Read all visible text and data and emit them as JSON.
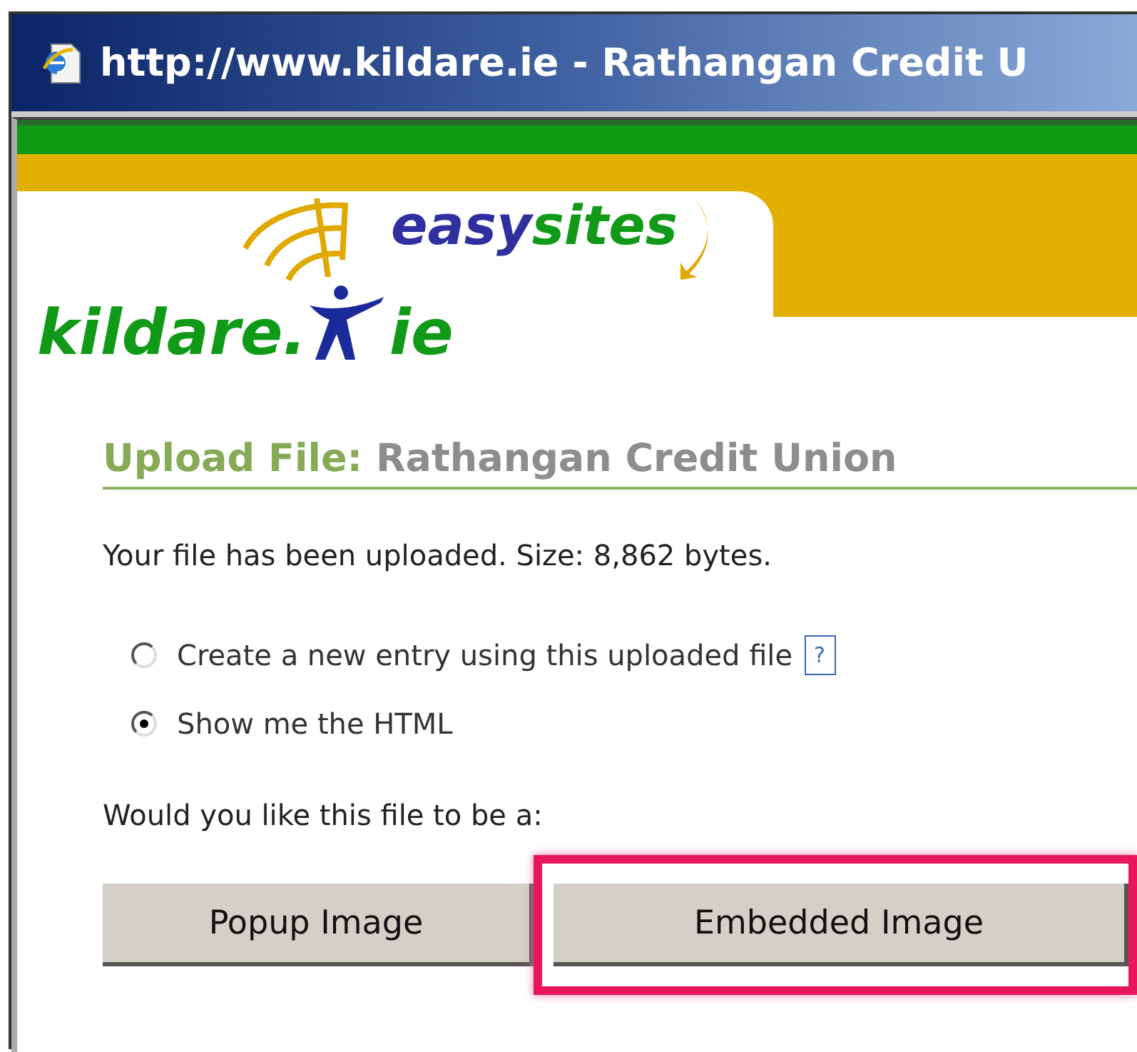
{
  "window": {
    "title": "http://www.kildare.ie - Rathangan Credit U"
  },
  "logo": {
    "brand_parts": [
      "easy",
      "sites"
    ],
    "site_parts": [
      "kildare.",
      "ie"
    ]
  },
  "heading": {
    "label": "Upload File:",
    "name": "Rathangan Credit Union"
  },
  "message": "Your file has been uploaded. Size: 8,862 bytes.",
  "options": [
    {
      "label": "Create a new entry using this uploaded file",
      "selected": false,
      "help": "?"
    },
    {
      "label": "Show me the HTML",
      "selected": true
    }
  ],
  "question": "Would you like this file to be a:",
  "buttons": [
    {
      "label": "Popup Image",
      "highlighted": false
    },
    {
      "label": "Embedded Image",
      "highlighted": true
    }
  ]
}
